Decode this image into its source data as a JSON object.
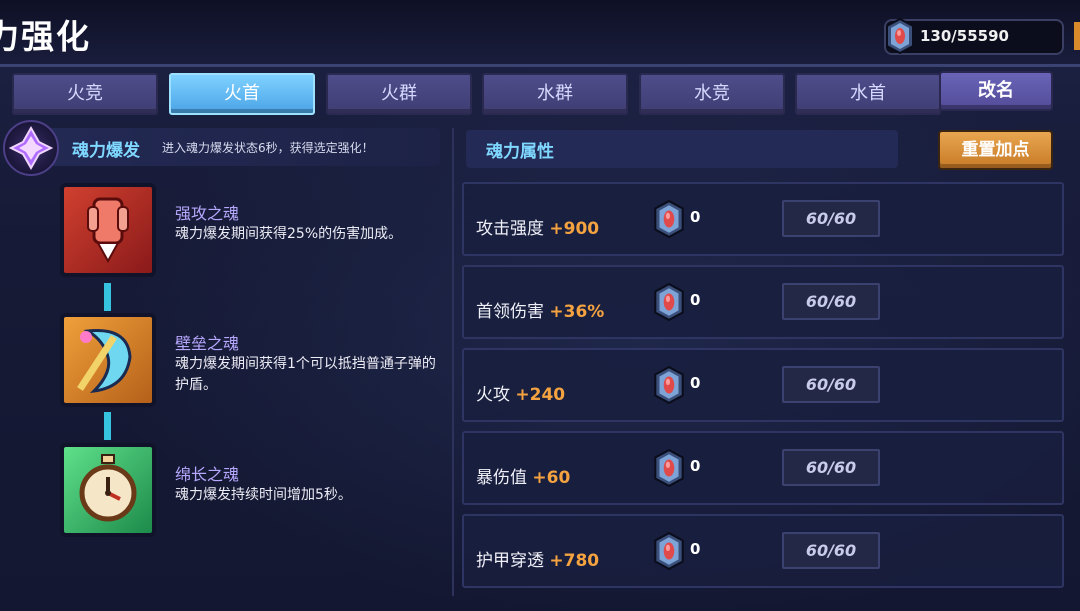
{
  "header": {
    "title": "力强化",
    "currency_amount": "130/55590",
    "currency_icon": "soul-gem-icon"
  },
  "tabs": [
    {
      "label": "火竞",
      "active": false
    },
    {
      "label": "火首",
      "active": true
    },
    {
      "label": "火群",
      "active": false
    },
    {
      "label": "水群",
      "active": false
    },
    {
      "label": "水竞",
      "active": false
    },
    {
      "label": "水首",
      "active": false
    }
  ],
  "rename_label": "改名",
  "burst": {
    "title": "魂力爆发",
    "description": "进入魂力爆发状态6秒，获得选定强化！"
  },
  "skills": [
    {
      "name": "强攻之魂",
      "desc": "魂力爆发期间获得25%的伤害加成。",
      "icon": "fist-icon"
    },
    {
      "name": "壁垒之魂",
      "desc": "魂力爆发期间获得1个可以抵挡普通子弹的护盾。",
      "icon": "shield-icon"
    },
    {
      "name": "绵长之魂",
      "desc": "魂力爆发持续时间增加5秒。",
      "icon": "stopwatch-icon"
    }
  ],
  "attributes": {
    "title": "魂力属性",
    "reset_label": "重置加点",
    "rows": [
      {
        "label": "攻击强度",
        "bonus": "+900",
        "count": "0",
        "level": "60/60"
      },
      {
        "label": "首领伤害",
        "bonus": "+36%",
        "count": "0",
        "level": "60/60"
      },
      {
        "label": "火攻",
        "bonus": "+240",
        "count": "0",
        "level": "60/60"
      },
      {
        "label": "暴伤值",
        "bonus": "+60",
        "count": "0",
        "level": "60/60"
      },
      {
        "label": "护甲穿透",
        "bonus": "+780",
        "count": "0",
        "level": "60/60"
      }
    ]
  },
  "colors": {
    "accent_cyan": "#7fd8ff",
    "bonus_orange": "#f4a340",
    "active_tab": "#4aa3e6",
    "skill_name": "#b7a8ff"
  }
}
